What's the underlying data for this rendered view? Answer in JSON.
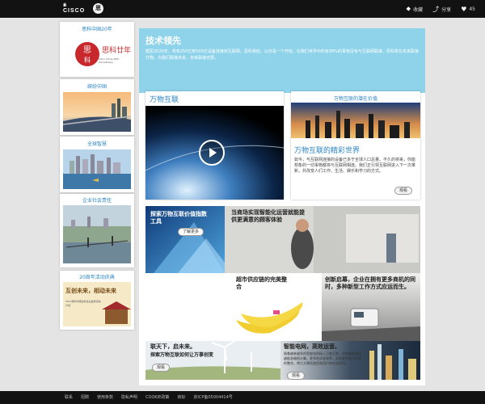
{
  "header": {
    "logo_text": "CISCO",
    "badge_text": "思",
    "tools": [
      {
        "icon": "tag-icon",
        "label": "收藏"
      },
      {
        "icon": "share-icon",
        "label": "分享"
      },
      {
        "icon": "heart-icon",
        "label": "45"
      }
    ]
  },
  "sidebar": {
    "cards": [
      {
        "title": "思科中国20年",
        "image_caption": "思科廿年",
        "image_sub": "Cisco China 20th Anniversary"
      },
      {
        "title": "缤纷中国"
      },
      {
        "title": "全球智慧"
      },
      {
        "title": "企业社会责任"
      },
      {
        "title": "20周年活动庆典",
        "image_caption": "互创未来，相动未来",
        "image_sub": "2014思科中国全新企业品牌活动计划"
      }
    ]
  },
  "main": {
    "title": "技术领先",
    "intro": "截至2020年，将有250亿到500亿设备连接到互联网。思科相信，以仅是一个开始，在我们世界中的有99%的事物没有与互联网联接，思科将在未来联接万物，为我们联接未来，未来联接无限。",
    "feature_left": {
      "label": "万物互联"
    },
    "feature_right": {
      "label": "万物互联的潜在价值",
      "heading": "万物互联的精彩世界",
      "body": "如今，与互联网连接的设备已多于全球人口总量。不久的将来，你能想象的一切事物都将与互联网相连。我们正引领互联网进入下一次革新，并改变人们工作、生活、娱乐和学习的方式。",
      "more": "观看"
    },
    "tiles": [
      {
        "title": "探索万物互联价值指数工具",
        "more": "了解更多"
      },
      {
        "title": "当商场实现智能化运营就能提供更满意的顾客体验"
      },
      {
        "title": "超市供应链的完美整合"
      },
      {
        "title": "创新启幕，企业在拥有更多商机的同时，多种新型工作方式应运而生。"
      },
      {
        "title": "联天下，启未来。",
        "subtitle": "探索万物互联如何让万事创变",
        "more": "观看"
      },
      {
        "title": "智能电网，高效运营。",
        "body": "随着越来越多的智能电网接入万物互联，用电需要越来越能准确地计算。更多地实现效率，实现更智能化运营的整合，将大大降低使用和用户的优化利用。",
        "more": "观看"
      }
    ]
  },
  "footer": {
    "links": [
      "联系",
      "招聘",
      "使用条款",
      "隐私声明",
      "COOKIE政策",
      "商标",
      "京ICP备05004414号"
    ]
  },
  "colors": {
    "accent": "#2a84c5",
    "header_band": "#8ed3ea",
    "topbar": "#121212"
  }
}
